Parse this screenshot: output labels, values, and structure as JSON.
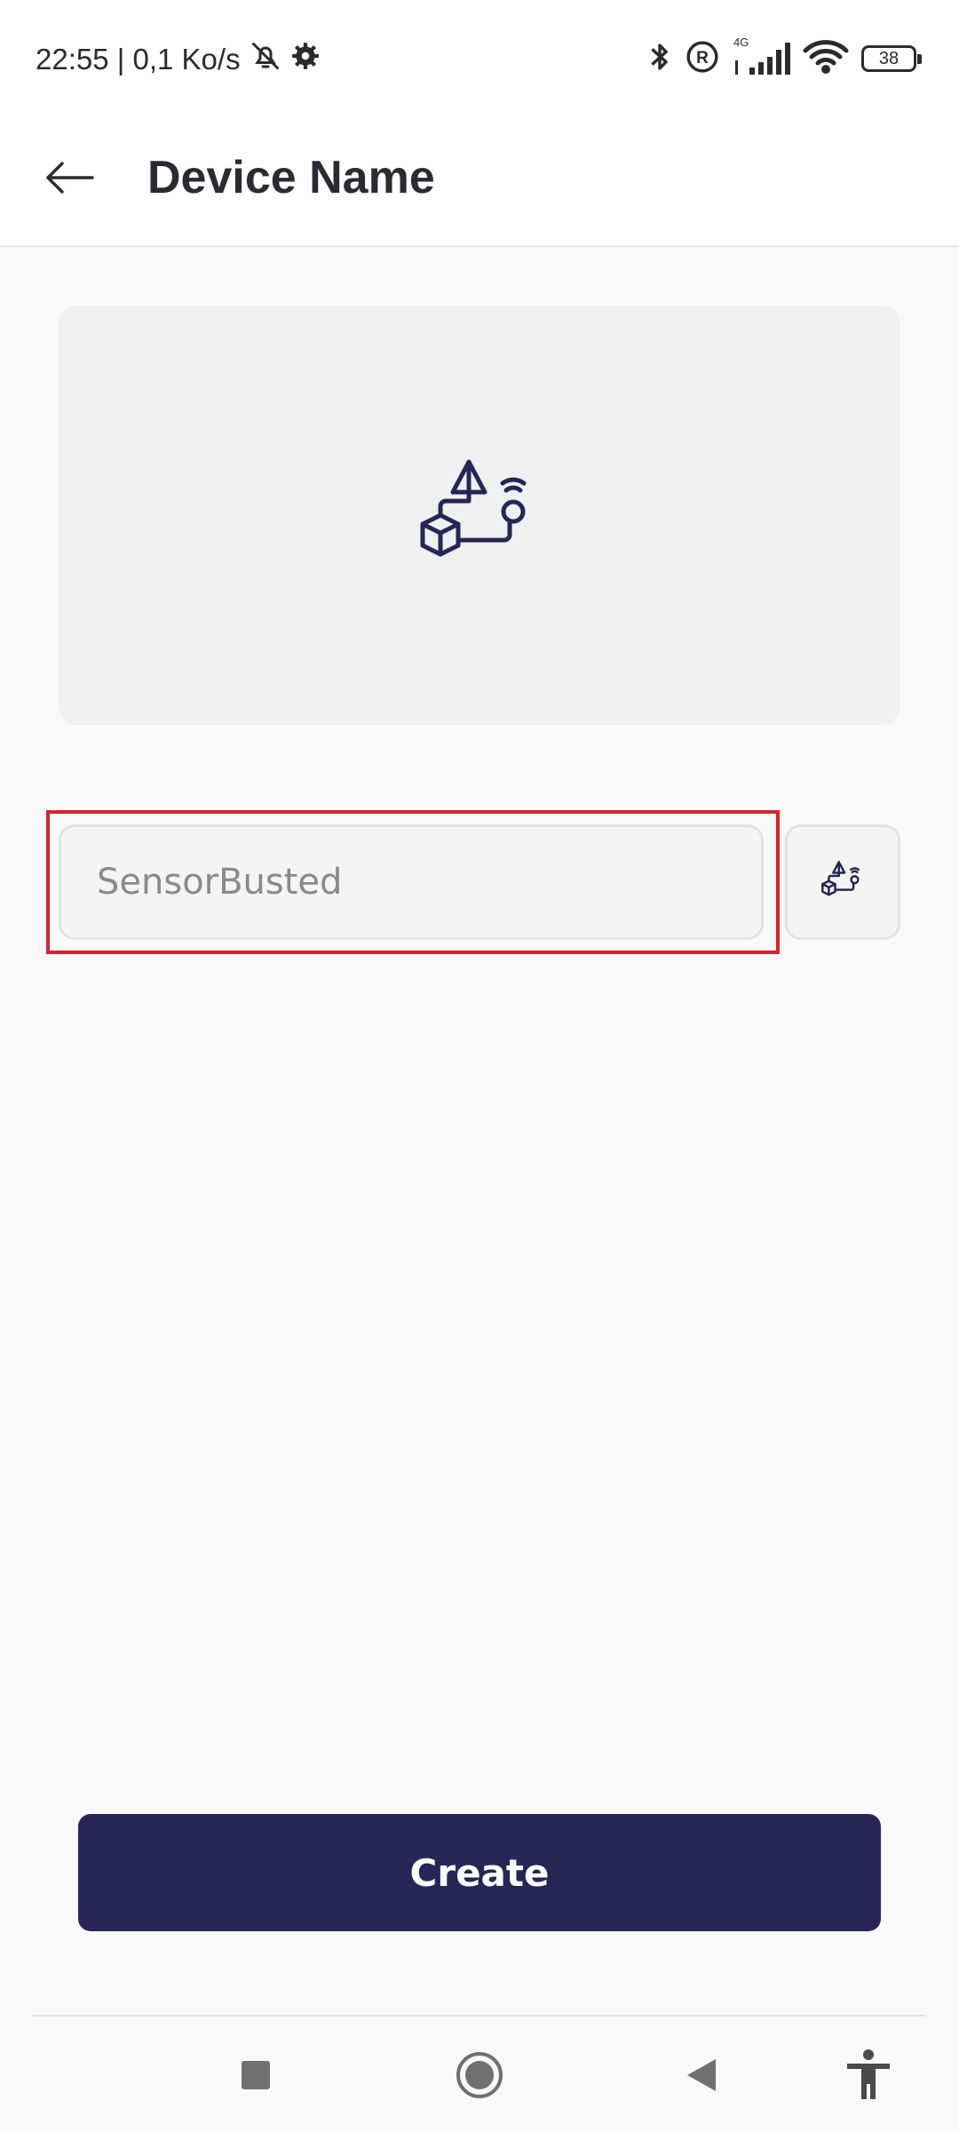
{
  "status_bar": {
    "time_speed": "22:55 | 0,1 Ko/s",
    "network_type": "4G",
    "battery_level": "38",
    "icons": [
      "mute-bell-icon",
      "settings-gear-icon",
      "bluetooth-icon",
      "roaming-icon",
      "signal-icon",
      "wifi-icon",
      "battery-icon"
    ]
  },
  "app_bar": {
    "title": "Device Name",
    "back_icon": "arrow-left-icon"
  },
  "preview": {
    "icon": "device-shapes-icon"
  },
  "name_field": {
    "placeholder": "SensorBusted",
    "value": ""
  },
  "icon_picker": {
    "icon": "device-shapes-icon"
  },
  "actions": {
    "create_label": "Create"
  },
  "nav_bar": {
    "icons": [
      "recents-square-icon",
      "home-circle-icon",
      "back-triangle-icon",
      "accessibility-icon"
    ]
  },
  "colors": {
    "primary": "#262656",
    "highlight": "#d2262e",
    "card_bg": "#eef1f0"
  }
}
